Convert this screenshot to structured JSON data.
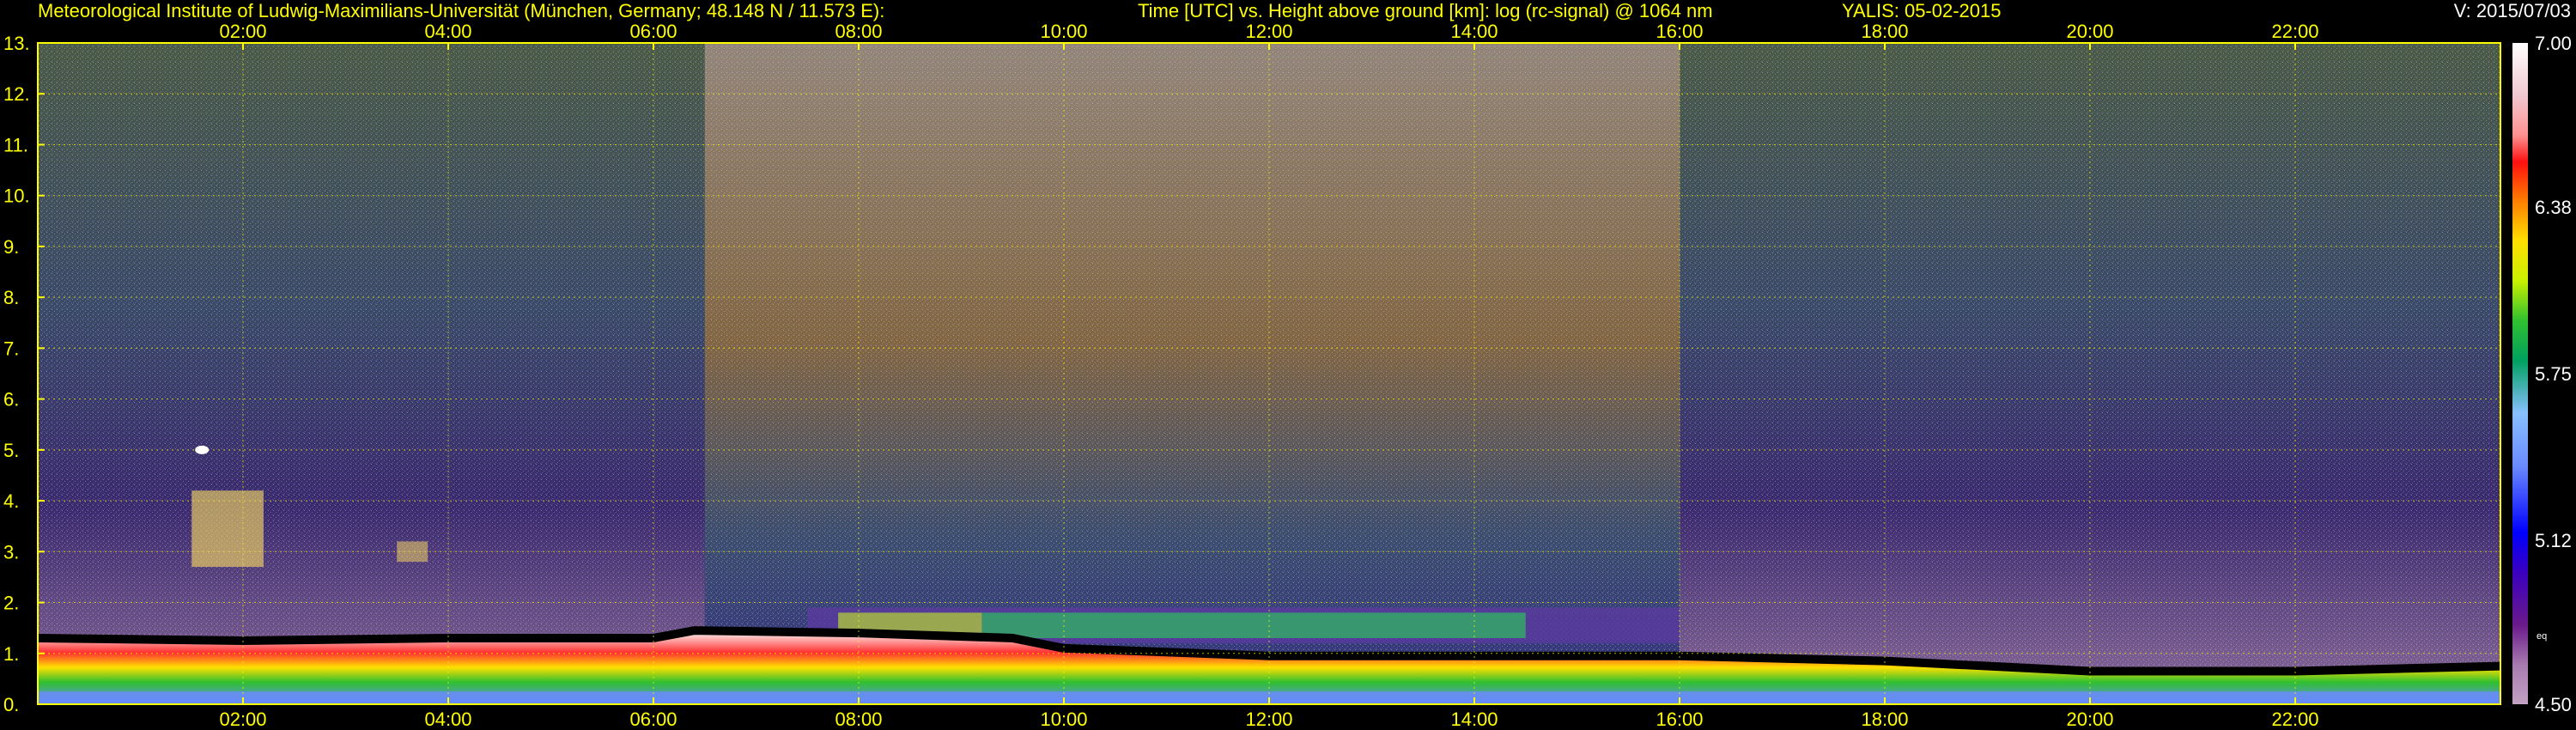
{
  "header": {
    "institute": "Meteorological Institute of Ludwig-Maximilians-Universität (München, Germany; 48.148 N / 11.573 E):",
    "axes_desc": "Time [UTC] vs. Height above ground [km]: log (rc-signal) @ 1064 nm",
    "instrument_date": "YALIS: 05-02-2015",
    "version": "V: 2015/07/03"
  },
  "colors": {
    "axis": "#ffff00",
    "background": "#000000",
    "colorbar_label": "#ffffff"
  },
  "chart_data": {
    "type": "heatmap",
    "title": "Time [UTC] vs. Height above ground [km]: log (rc-signal) @ 1064 nm",
    "x_ticks": [
      "02:00",
      "04:00",
      "06:00",
      "08:00",
      "10:00",
      "12:00",
      "14:00",
      "16:00",
      "18:00",
      "20:00",
      "22:00"
    ],
    "x_tick_hours": [
      2,
      4,
      6,
      8,
      10,
      12,
      14,
      16,
      18,
      20,
      22
    ],
    "xlim": [
      0,
      24
    ],
    "y_ticks": [
      "0.",
      "1.",
      "2.",
      "3.",
      "4.",
      "5.",
      "6.",
      "7.",
      "8.",
      "9.",
      "10.",
      "11.",
      "12.",
      "13."
    ],
    "y_tick_values": [
      0,
      1,
      2,
      3,
      4,
      5,
      6,
      7,
      8,
      9,
      10,
      11,
      12,
      13
    ],
    "ylim": [
      0,
      13
    ],
    "grid": true,
    "colorbar": {
      "ticks": [
        "7.00",
        "6.38",
        "5.75",
        "5.12",
        "4.50"
      ],
      "tick_values": [
        7.0,
        6.38,
        5.75,
        5.12,
        4.5
      ],
      "range": [
        4.5,
        7.0
      ],
      "note": "eq"
    },
    "features": {
      "boundary_layer_top_km": [
        [
          0.0,
          1.3
        ],
        [
          2.0,
          1.25
        ],
        [
          4.0,
          1.3
        ],
        [
          6.0,
          1.3
        ],
        [
          6.4,
          1.45
        ],
        [
          8.0,
          1.4
        ],
        [
          9.5,
          1.3
        ],
        [
          10.0,
          1.1
        ],
        [
          12.0,
          0.95
        ],
        [
          14.0,
          0.95
        ],
        [
          16.0,
          0.95
        ],
        [
          18.0,
          0.85
        ],
        [
          20.0,
          0.65
        ],
        [
          22.0,
          0.65
        ],
        [
          24.0,
          0.75
        ]
      ],
      "residual_layer_top_km": [
        [
          7.5,
          1.9
        ],
        [
          16.0,
          1.9
        ]
      ],
      "aerosol_layer": {
        "start_hour": 1.5,
        "end_hour": 2.2,
        "base_km": 2.7,
        "top_km": 4.2
      },
      "cloud_spot": {
        "hour": 1.6,
        "height_km": 5.0
      },
      "daytime_noise": {
        "start_hour": 6.5,
        "end_hour": 16.0
      }
    }
  }
}
